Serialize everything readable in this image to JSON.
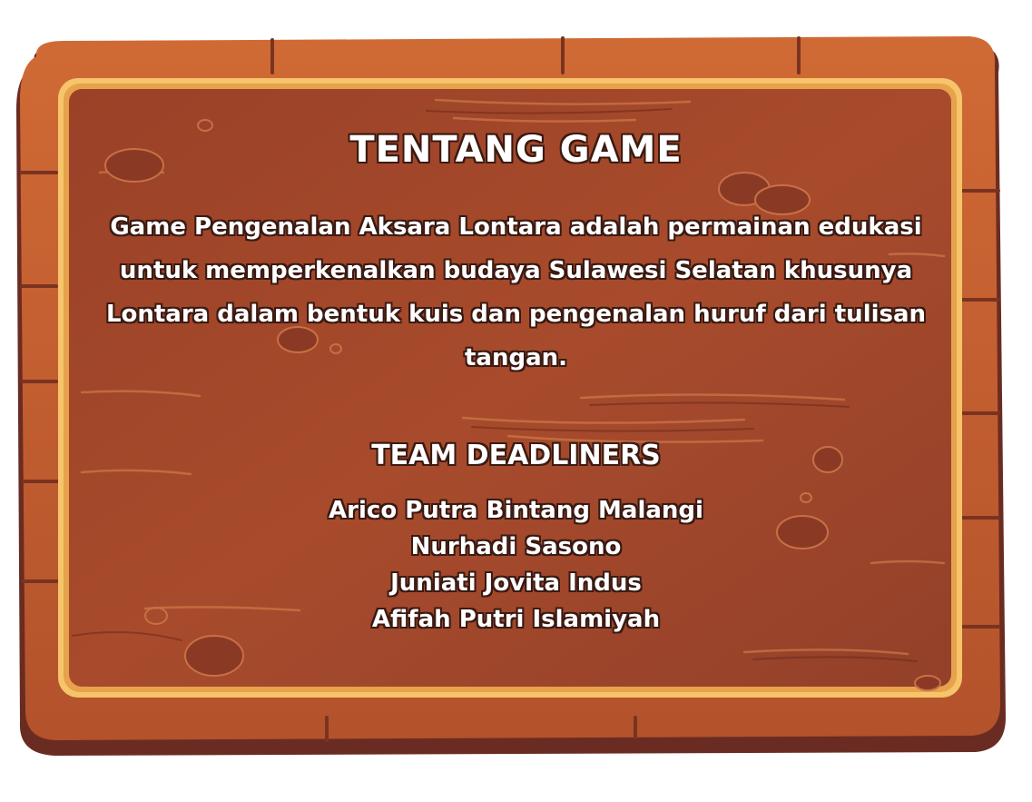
{
  "about": {
    "title": "TENTANG GAME",
    "description": "Game Pengenalan Aksara Lontara adalah permainan edukasi untuk memperkenalkan budaya Sulawesi Selatan khusunya Lontara dalam bentuk  kuis dan pengenalan huruf dari tulisan tangan."
  },
  "team": {
    "title": "TEAM DEADLINERS",
    "members": [
      "Arico Putra Bintang Malangi",
      "Nurhadi Sasono",
      "Juniati Jovita Indus",
      "Afifah Putri Islamiyah"
    ]
  },
  "colors": {
    "wood_dark": "#6b2f1f",
    "wood_mid": "#a5472a",
    "wood_light": "#c0602f",
    "frame_gold": "#f6c46a",
    "text": "#ffffff",
    "text_outline": "#3a1a12"
  }
}
